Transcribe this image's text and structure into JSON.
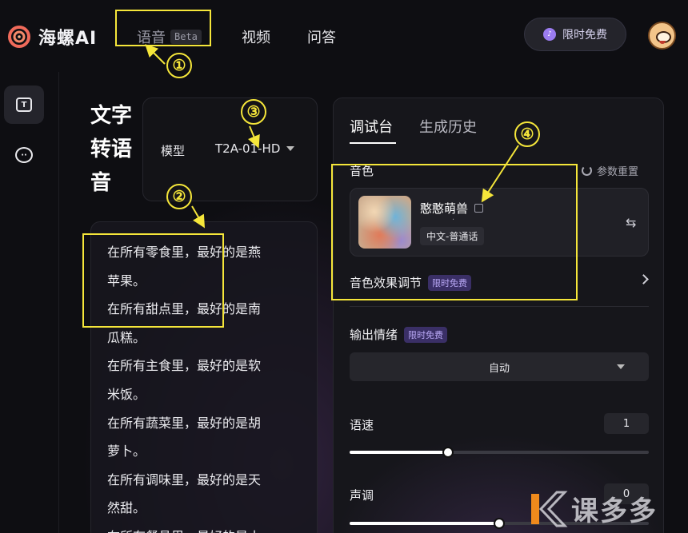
{
  "header": {
    "brand": "海螺AI",
    "nav": [
      {
        "label": "语音",
        "badge": "Beta"
      },
      {
        "label": "视频"
      },
      {
        "label": "问答"
      }
    ],
    "free_button": "限时免费"
  },
  "page": {
    "title": "文字转语音"
  },
  "model": {
    "label": "模型",
    "value": "T2A-01-HD"
  },
  "text_input": {
    "lines": [
      "在所有零食里，最好的是燕",
      "苹果。",
      "在所有甜点里，最好的是南",
      "瓜糕。",
      "在所有主食里，最好的是软",
      "米饭。",
      "在所有蔬菜里，最好的是胡",
      "萝卜。",
      "在所有调味里，最好的是天",
      "然甜。",
      "在所有餐具里，最好的是小"
    ]
  },
  "panel": {
    "tabs": [
      "调试台",
      "生成历史"
    ],
    "timbre_label": "音色",
    "reset_label": "参数重置",
    "voice": {
      "name": "憨憨萌兽",
      "dot": "·",
      "tag": "中文-普通话",
      "swap_icon": "⇆"
    },
    "effect_label": "音色效果调节",
    "effect_badge": "限时免费",
    "emotion_label": "输出情绪",
    "emotion_badge": "限时免费",
    "emotion_value": "自动",
    "speed_label": "语速",
    "speed_value": "1",
    "speed_fill": 0.33,
    "pitch_label": "声调",
    "pitch_value": "0",
    "pitch_fill": 0.5
  },
  "annotations": [
    "①",
    "②",
    "③",
    "④"
  ],
  "watermark": "课多多"
}
